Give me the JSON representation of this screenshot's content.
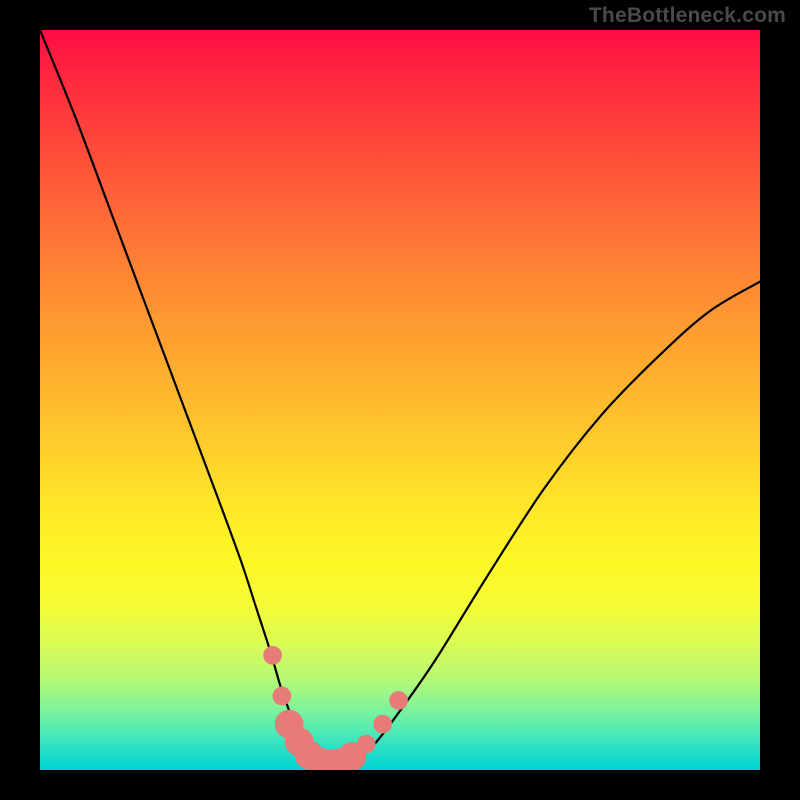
{
  "watermark": "TheBottleneck.com",
  "chart_data": {
    "type": "line",
    "title": "",
    "xlabel": "",
    "ylabel": "",
    "xlim": [
      0,
      100
    ],
    "ylim": [
      0,
      100
    ],
    "grid": false,
    "legend": false,
    "background": {
      "type": "vertical-gradient",
      "stops": [
        {
          "pos": 0,
          "color": "#ff0c45"
        },
        {
          "pos": 16,
          "color": "#ff4b3a"
        },
        {
          "pos": 35,
          "color": "#ff8c33"
        },
        {
          "pos": 55,
          "color": "#ffc92c"
        },
        {
          "pos": 72,
          "color": "#fdf826"
        },
        {
          "pos": 88,
          "color": "#b2f978"
        },
        {
          "pos": 100,
          "color": "#00d4d2"
        }
      ]
    },
    "series": [
      {
        "name": "bottleneck-curve",
        "color": "#000000",
        "x": [
          0,
          5,
          10,
          15,
          20,
          25,
          28,
          30,
          32,
          33.5,
          35,
          36,
          37,
          38,
          39.5,
          41,
          43,
          46,
          50,
          55,
          62,
          70,
          78,
          86,
          93,
          100
        ],
        "y": [
          100,
          88,
          75,
          62,
          49,
          36,
          28,
          22,
          16,
          11,
          7,
          4,
          2,
          1,
          0,
          0,
          1,
          3,
          8,
          15,
          26,
          38,
          48,
          56,
          62,
          66
        ]
      }
    ],
    "markers": {
      "name": "highlight-points",
      "color": "#e77b78",
      "radius_small": 1.3,
      "radius_large": 2.0,
      "points": [
        {
          "x": 32.3,
          "y": 15.5,
          "size": "small"
        },
        {
          "x": 33.6,
          "y": 10.0,
          "size": "small"
        },
        {
          "x": 34.6,
          "y": 6.2,
          "size": "large"
        },
        {
          "x": 36.0,
          "y": 3.8,
          "size": "large"
        },
        {
          "x": 37.4,
          "y": 2.0,
          "size": "large"
        },
        {
          "x": 38.8,
          "y": 1.1,
          "size": "large"
        },
        {
          "x": 40.3,
          "y": 0.8,
          "size": "large"
        },
        {
          "x": 41.8,
          "y": 1.0,
          "size": "large"
        },
        {
          "x": 43.3,
          "y": 1.8,
          "size": "large"
        },
        {
          "x": 45.3,
          "y": 3.5,
          "size": "small"
        },
        {
          "x": 47.6,
          "y": 6.2,
          "size": "small"
        },
        {
          "x": 49.8,
          "y": 9.4,
          "size": "small"
        }
      ]
    }
  }
}
